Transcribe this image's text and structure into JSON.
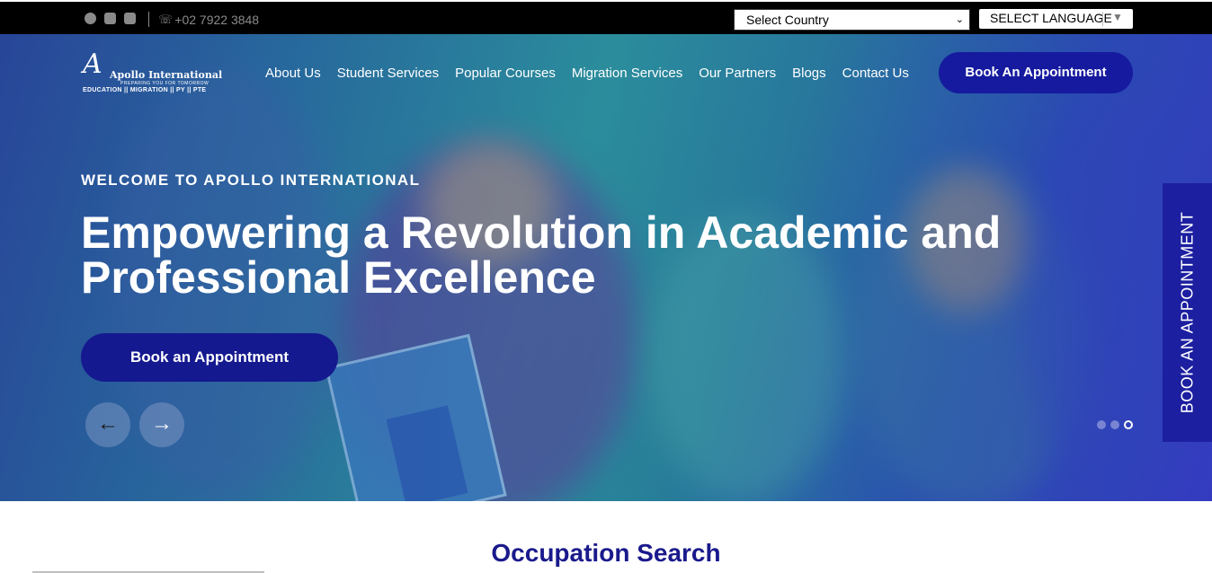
{
  "topbar": {
    "social": [
      "facebook-icon",
      "linkedin-icon",
      "instagram-icon"
    ],
    "phone": "+02 7922 3848",
    "country_select": "Select Country",
    "language_select": "SELECT LANGUAGE"
  },
  "logo": {
    "mark": "A",
    "name": "Apollo International",
    "tagline": "PREPARING YOU FOR TOMORROW",
    "sub": "EDUCATION || MIGRATION || PY || PTE"
  },
  "nav": {
    "items": [
      "About Us",
      "Student Services",
      "Popular Courses",
      "Migration Services",
      "Our Partners",
      "Blogs",
      "Contact Us"
    ],
    "book_button": "Book An Appointment"
  },
  "hero": {
    "welcome": "WELCOME TO APOLLO INTERNATIONAL",
    "headline": "Empowering a Revolution in Academic and Professional Excellence",
    "cta": "Book an Appointment",
    "prev_arrow": "←",
    "next_arrow": "→",
    "slides": 3,
    "active_slide": 3
  },
  "side_tab": {
    "label": "BOOK AN APPOINTMENT"
  },
  "section": {
    "title": "Occupation Search"
  },
  "colors": {
    "primary": "#151a9e",
    "heading": "#1a1a8c",
    "topbar": "#000000"
  }
}
